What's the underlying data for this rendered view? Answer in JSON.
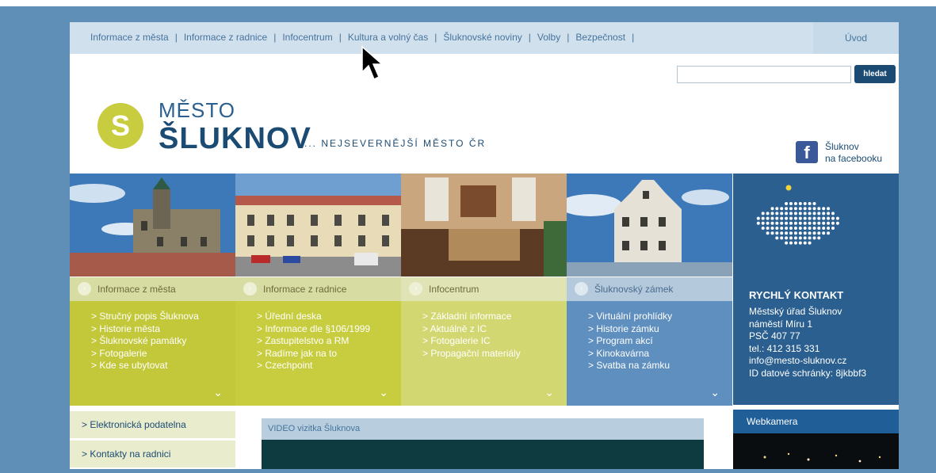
{
  "nav": {
    "items": [
      "Informace z města",
      "Informace z radnice",
      "Infocentrum",
      "Kultura a volný čas",
      "Šluknovské noviny",
      "Volby",
      "Bezpečnost"
    ],
    "home": "Úvod"
  },
  "search": {
    "placeholder": "",
    "button": "hledat"
  },
  "logo": {
    "line1": "MĚSTO",
    "line2": "ŠLUKNOV",
    "tagline": "... NEJSEVERNĚJŠÍ MĚSTO ČR"
  },
  "facebook": {
    "line1": "Šluknov",
    "line2": "na facebooku"
  },
  "columns": [
    {
      "title": "Informace z města",
      "links": [
        "> Stručný popis Šluknova",
        "> Historie města",
        "> Šluknovské památky",
        "> Fotogalerie",
        "> Kde se ubytovat"
      ]
    },
    {
      "title": "Informace z radnice",
      "links": [
        "> Úřední deska",
        "> Informace dle §106/1999",
        "> Zastupitelstvo a RM",
        "> Radíme jak na to",
        "> Czechpoint"
      ]
    },
    {
      "title": "Infocentrum",
      "links": [
        "> Základní informace",
        "> Aktuálně z IC",
        "> Fotogalerie IC",
        "> Propagační materiály"
      ]
    },
    {
      "title": "Šluknovský zámek",
      "links": [
        "> Virtuální prohlídky",
        "> Historie zámku",
        "> Program akcí",
        "> Kinokavárna",
        "> Svatba na zámku"
      ]
    }
  ],
  "contact": {
    "title": "RYCHLÝ KONTAKT",
    "lines": [
      "Městský úřad Šluknov",
      "náměstí Míru 1",
      "PSČ 407 77",
      "tel.: 412 315 331",
      "info@mesto-sluknov.cz",
      "ID datové schránky: 8jkbbf3"
    ]
  },
  "sidebar": {
    "links": [
      "> Elektronická podatelna",
      "> Kontakty na radnici"
    ]
  },
  "video": {
    "title": "VIDEO vizitka Šluknova"
  },
  "webcam": {
    "title": "Webkamera"
  },
  "colors": {
    "accent": "#1b4b73",
    "lime": "#c8cd3f",
    "background": "#5f8fb6"
  }
}
